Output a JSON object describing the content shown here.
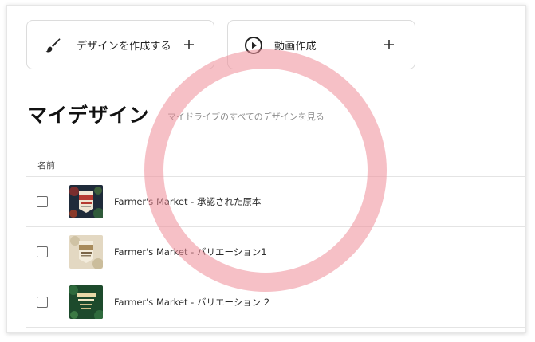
{
  "actions": {
    "create_design_label": "デザインを作成する",
    "create_video_label": "動画作成"
  },
  "page": {
    "title": "マイデザイン",
    "drive_link": "マイドライブのすべてのデザインを見る"
  },
  "table": {
    "name_header": "名前",
    "rows": [
      {
        "title": "Farmer's Market - 承認された原本"
      },
      {
        "title": "Farmer's Market - バリエーション1"
      },
      {
        "title": "Farmer's Market - バリエーション 2"
      }
    ]
  },
  "icons": {
    "design": "paintbrush-icon",
    "video": "play-circle-icon",
    "add": "plus-icon"
  },
  "colors": {
    "highlight_ring": "#ee8c98",
    "border": "#dcdcdc"
  }
}
